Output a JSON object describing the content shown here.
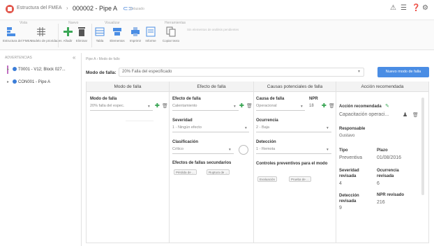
{
  "titlebar": {
    "breadcrumb_root": "Estructura del FMEA",
    "separator": "›",
    "breadcrumb_current": "000002 - Pipe A",
    "link_icon": "link-icon",
    "sub_label": "Enlazado",
    "actions": [
      "notifications-icon",
      "list-icon",
      "help-icon",
      "settings-icon"
    ]
  },
  "ribbon": {
    "groups": [
      "Vista",
      "Nuevo",
      "Visualizar",
      "Herramientas"
    ],
    "note": "Sin elementos de análisis pendientes",
    "buttons": [
      {
        "label": "Estructura del FMEA",
        "icon": "structure-icon"
      },
      {
        "label": "Modelo de prioridades",
        "icon": "priority-grid-icon"
      },
      {
        "label": "Añadir",
        "icon": "add-icon"
      },
      {
        "label": "Eliminar",
        "icon": "delete-icon"
      },
      {
        "label": "Tabla",
        "icon": "table-icon"
      },
      {
        "label": "Elementos",
        "icon": "elements-icon"
      },
      {
        "label": "Imprimir",
        "icon": "print-icon"
      },
      {
        "label": "Informe",
        "icon": "report-icon"
      },
      {
        "label": "Copiar texto",
        "icon": "copy-icon"
      }
    ]
  },
  "sidebar": {
    "label": "ADVERTENCIAS",
    "items": [
      {
        "label": "T0001 - V12; Block 027..."
      },
      {
        "label": "CON001 - Pipe A"
      }
    ]
  },
  "main": {
    "path": "Pipe A › Modo de fallo",
    "modo_label": "Modo de falla:",
    "modo_value": "20% Falla del especificado",
    "new_button": "Nuevo modo de falla",
    "columns": [
      "Modo de falla",
      "Efecto de falla",
      "Causas potenciales de falla",
      "Acción recomendada"
    ],
    "col1": {
      "label": "Modo de falla",
      "value": "20% falla del espec."
    },
    "col2": {
      "efecto_label": "Efecto de falla",
      "efecto_value": "Calentamiento",
      "severidad_label": "Severidad",
      "severidad_value": "1 - Ningún efecto",
      "clasificacion_label": "Clasificación",
      "clasificacion_value": "Crítico",
      "secundarios_label": "Efectos de fallas secundarios",
      "chips": [
        "Pérdida de ...",
        "Ruptura de ..."
      ]
    },
    "col3": {
      "causa_label": "Causa de falla",
      "npr_label": "NPR",
      "causa_value": "Operacional",
      "npr_value": "18",
      "ocurrencia_label": "Ocurrencia",
      "ocurrencia_value": "2 - Baja",
      "deteccion_label": "Detección",
      "deteccion_value": "1 - Remota",
      "controles_label": "Controles preventivos para el modo",
      "chips": [
        "Evaluación",
        "Prueba de ..."
      ]
    },
    "col4": {
      "accion_label": "Acción recomendada",
      "accion_value": "Capacitación operaci...",
      "responsable_label": "Responsable",
      "responsable_value": "Gustavo",
      "tipo_label": "Tipo",
      "tipo_value": "Preventiva",
      "plazo_label": "Plazo",
      "plazo_value": "01/08/2016",
      "sev_rev_label": "Severidad revisada",
      "sev_rev_value": "4",
      "oc_rev_label": "Ocurrencia revisada",
      "oc_rev_value": "6",
      "det_rev_label": "Detección revisada",
      "det_rev_value": "9",
      "npr_rev_label": "NPR revisado",
      "npr_rev_value": "216"
    }
  },
  "colors": {
    "accent": "#4a8de4",
    "add_green": "#3aa655",
    "logo_red": "#e2574c"
  }
}
